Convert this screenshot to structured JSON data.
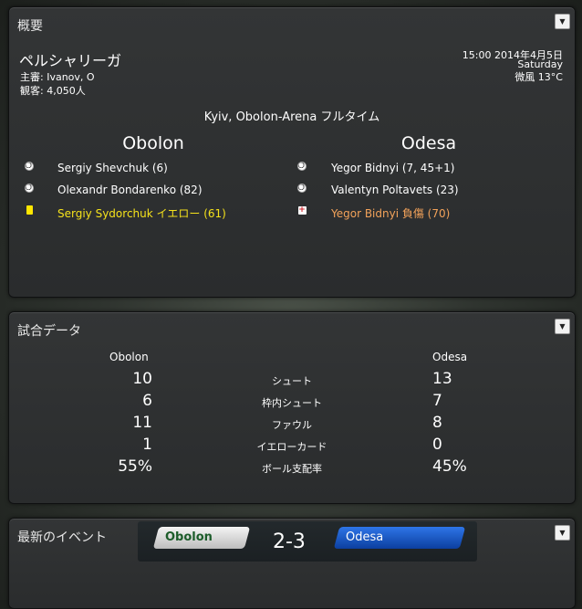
{
  "overview": {
    "title": "概要",
    "competition": "ペルシャリーガ",
    "referee": "主審: Ivanov, O",
    "attendance": "観客: 4,050人",
    "datetime": "15:00 2014年4月5日",
    "weekday": "Saturday",
    "weather": "微風 13°C",
    "venue": "Kyiv, Obolon-Arena フルタイム",
    "home_team": "Obolon",
    "away_team": "Odesa",
    "home_events": [
      {
        "icon": "goal-ball-icon",
        "text": "Sergiy Shevchuk (6)",
        "color": "#ffffff"
      },
      {
        "icon": "goal-ball-icon",
        "text": "Olexandr Bondarenko (82)",
        "color": "#ffffff"
      },
      {
        "icon": "yellow-card-icon",
        "text": "Sergiy Sydorchuk イエロー (61)",
        "color": "#f5e21b"
      }
    ],
    "away_events": [
      {
        "icon": "goal-ball-icon",
        "text": "Yegor Bidnyi (7, 45+1)",
        "color": "#ffffff"
      },
      {
        "icon": "goal-ball-icon",
        "text": "Valentyn Poltavets (23)",
        "color": "#ffffff"
      },
      {
        "icon": "injury-icon",
        "text": "Yegor Bidnyi 負傷 (70)",
        "color": "#f2a25a"
      }
    ]
  },
  "match_stats": {
    "title": "試合データ",
    "home_team": "Obolon",
    "away_team": "Odesa",
    "rows": [
      {
        "home": "10",
        "label": "シュート",
        "away": "13"
      },
      {
        "home": "6",
        "label": "枠内シュート",
        "away": "7"
      },
      {
        "home": "11",
        "label": "ファウル",
        "away": "8"
      },
      {
        "home": "1",
        "label": "イエローカード",
        "away": "0"
      },
      {
        "home": "55%",
        "label": "ボール支配率",
        "away": "45%"
      }
    ]
  },
  "latest_events": {
    "title": "最新のイベント",
    "home_team": "Obolon",
    "score": "2-3",
    "away_team": "Odesa"
  },
  "colors": {
    "yellow_event": "#f5e21b",
    "injury_event": "#f2a25a",
    "home_pill_text": "#1c5c2a",
    "away_pill": "#1d5fd0"
  }
}
